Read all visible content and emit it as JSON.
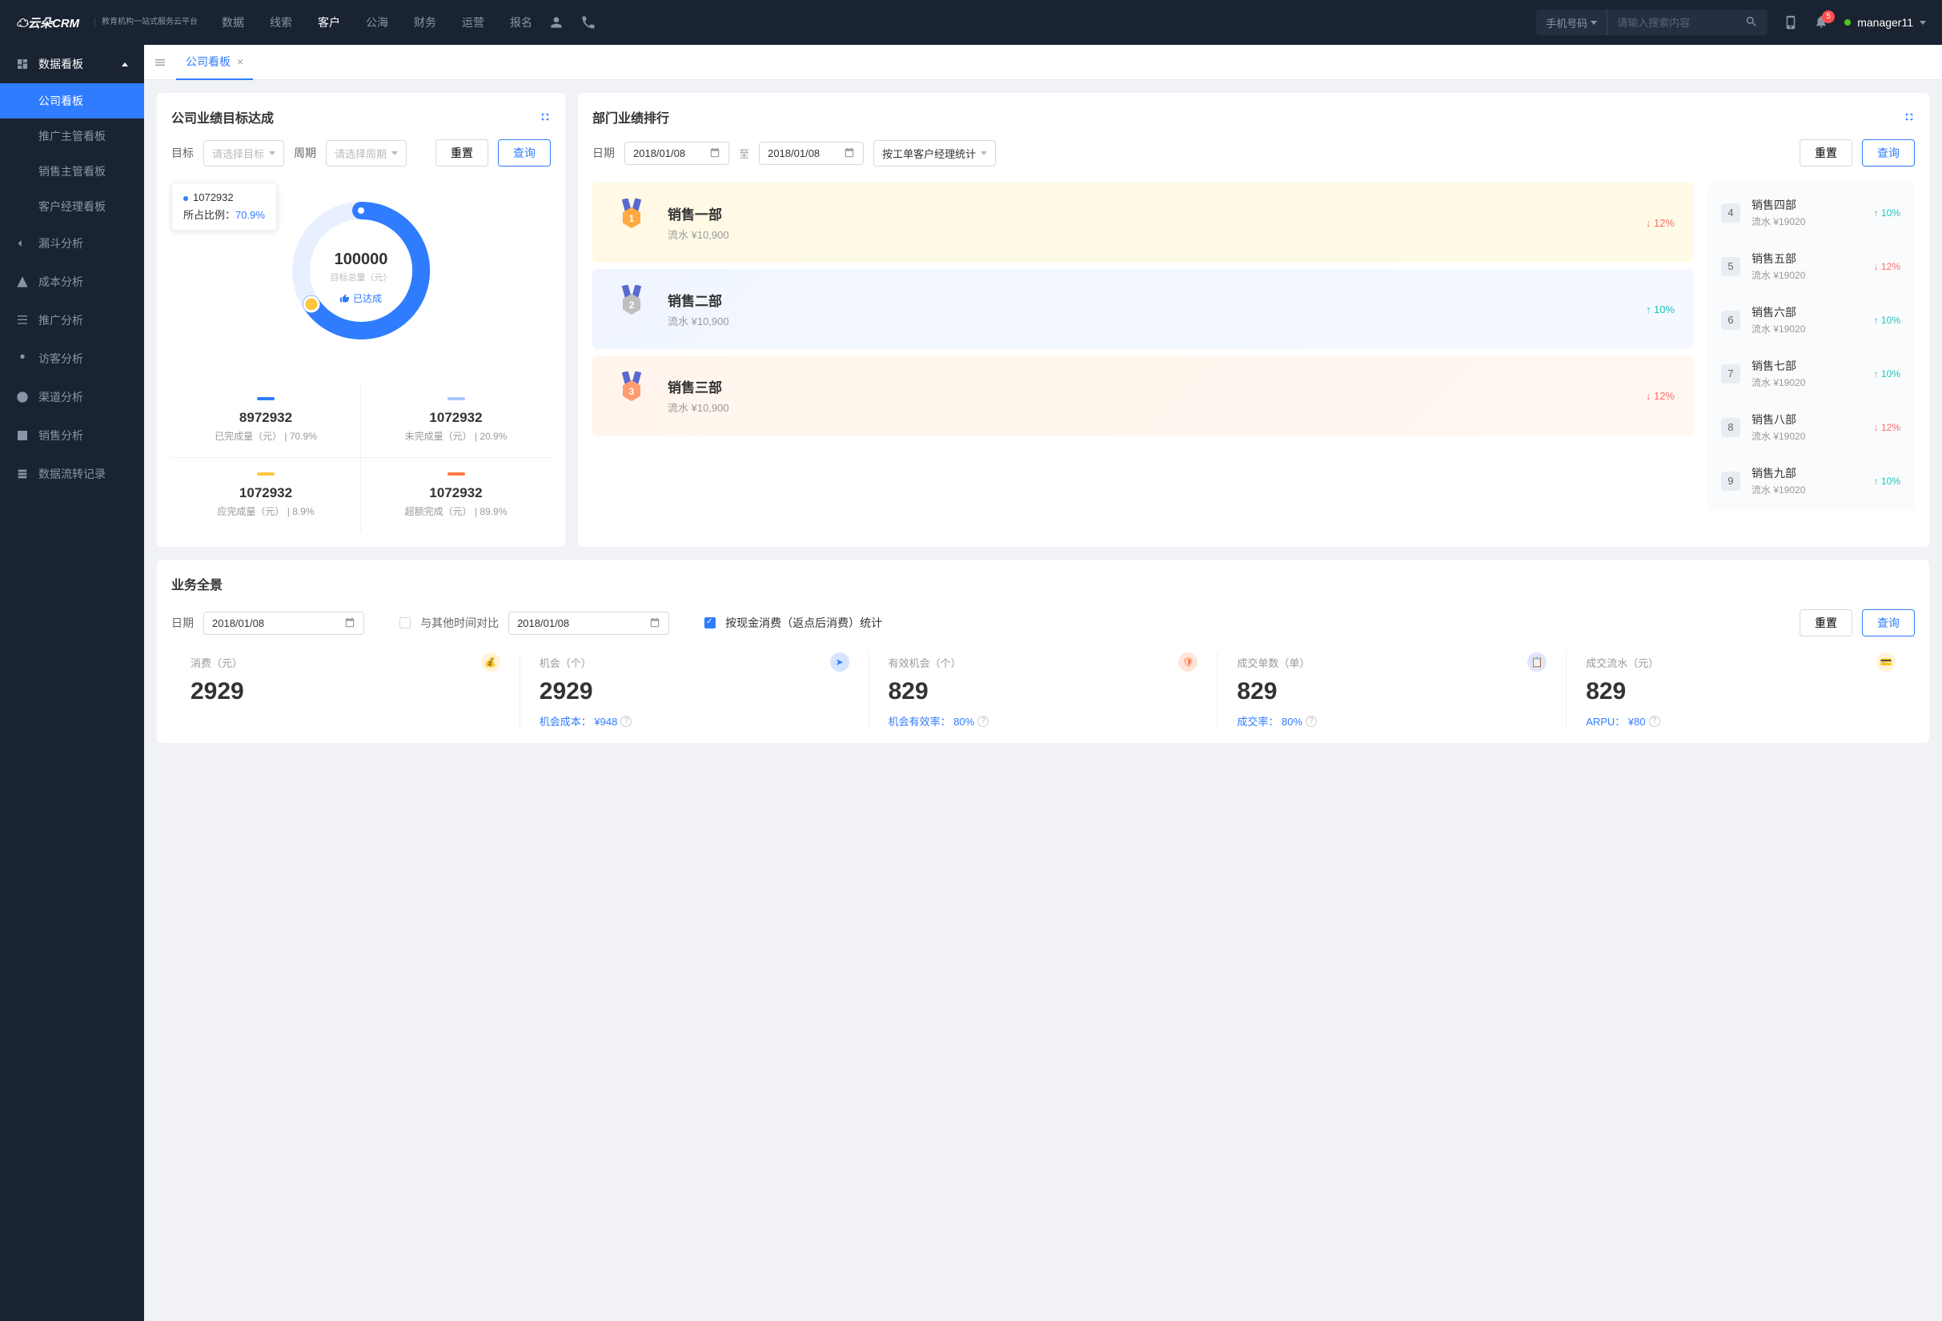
{
  "logo_suffix": "教育机构一站式服务云平台",
  "nav": [
    "数据",
    "线索",
    "客户",
    "公海",
    "财务",
    "运营",
    "报名"
  ],
  "nav_active": 2,
  "search_type": "手机号码",
  "search_placeholder": "请输入搜索内容",
  "notif_count": "5",
  "username": "manager11",
  "sidebar": {
    "group": "数据看板",
    "subs": [
      "公司看板",
      "推广主管看板",
      "销售主管看板",
      "客户经理看板"
    ],
    "sub_active": 0,
    "items": [
      "漏斗分析",
      "成本分析",
      "推广分析",
      "访客分析",
      "渠道分析",
      "销售分析",
      "数据流转记录"
    ]
  },
  "tab": "公司看板",
  "card1": {
    "title": "公司业绩目标达成",
    "target_lbl": "目标",
    "target_ph": "请选择目标",
    "period_lbl": "周期",
    "period_ph": "请选择周期",
    "reset": "重置",
    "query": "查询",
    "tooltip_val": "1072932",
    "tooltip_lbl": "所占比例：",
    "tooltip_pct": "70.9%",
    "center_num": "100000",
    "center_lbl": "目标总量（元）",
    "center_badge": "已达成",
    "stats": [
      {
        "bar": "#2f7cff",
        "val": "8972932",
        "sub": "已完成量（元） | 70.9%"
      },
      {
        "bar": "#a8c8ff",
        "val": "1072932",
        "sub": "未完成量（元） | 20.9%"
      },
      {
        "bar": "#ffc53d",
        "val": "1072932",
        "sub": "应完成量（元） | 8.9%"
      },
      {
        "bar": "#ff7a45",
        "val": "1072932",
        "sub": "超额完成（元） | 89.9%"
      }
    ]
  },
  "card2": {
    "title": "部门业绩排行",
    "date_lbl": "日期",
    "date1": "2018/01/08",
    "date_sep": "至",
    "date2": "2018/01/08",
    "stat_by": "按工单客户经理统计",
    "reset": "重置",
    "query": "查询",
    "top3": [
      {
        "cls": "gold",
        "name": "销售一部",
        "rev": "流水 ¥10,900",
        "chg": "12%",
        "dir": "down"
      },
      {
        "cls": "silver",
        "name": "销售二部",
        "rev": "流水 ¥10,900",
        "chg": "10%",
        "dir": "up"
      },
      {
        "cls": "bronze",
        "name": "销售三部",
        "rev": "流水 ¥10,900",
        "chg": "12%",
        "dir": "down"
      }
    ],
    "rest": [
      {
        "n": "4",
        "name": "销售四部",
        "rev": "流水 ¥19020",
        "chg": "10%",
        "dir": "up"
      },
      {
        "n": "5",
        "name": "销售五部",
        "rev": "流水 ¥19020",
        "chg": "12%",
        "dir": "down"
      },
      {
        "n": "6",
        "name": "销售六部",
        "rev": "流水 ¥19020",
        "chg": "10%",
        "dir": "up"
      },
      {
        "n": "7",
        "name": "销售七部",
        "rev": "流水 ¥19020",
        "chg": "10%",
        "dir": "up"
      },
      {
        "n": "8",
        "name": "销售八部",
        "rev": "流水 ¥19020",
        "chg": "12%",
        "dir": "down"
      },
      {
        "n": "9",
        "name": "销售九部",
        "rev": "流水 ¥19020",
        "chg": "10%",
        "dir": "up"
      }
    ]
  },
  "card3": {
    "title": "业务全景",
    "date_lbl": "日期",
    "date1": "2018/01/08",
    "compare_lbl": "与其他时间对比",
    "date2": "2018/01/08",
    "cash_lbl": "按现金消费（返点后消费）统计",
    "reset": "重置",
    "query": "查询",
    "kpis": [
      {
        "label": "消费（元）",
        "val": "2929",
        "sub": "",
        "color": "#ffc53d"
      },
      {
        "label": "机会（个）",
        "val": "2929",
        "sub": "机会成本： ¥948",
        "color": "#2f7cff"
      },
      {
        "label": "有效机会（个）",
        "val": "829",
        "sub": "机会有效率： 80%",
        "color": "#ff7a45"
      },
      {
        "label": "成交单数（单）",
        "val": "829",
        "sub": "成交率： 80%",
        "color": "#597ef7"
      },
      {
        "label": "成交流水（元）",
        "val": "829",
        "sub": "ARPU： ¥80",
        "color": "#ffc53d"
      }
    ]
  },
  "chart_data": {
    "type": "pie",
    "title": "目标总量（元）",
    "total": 100000,
    "series": [
      {
        "name": "已完成量",
        "value": 8972932,
        "pct": 70.9,
        "color": "#2f7cff"
      },
      {
        "name": "未完成量",
        "value": 1072932,
        "pct": 20.9,
        "color": "#a8c8ff"
      },
      {
        "name": "应完成量",
        "value": 1072932,
        "pct": 8.9,
        "color": "#ffc53d"
      },
      {
        "name": "超额完成",
        "value": 1072932,
        "pct": 89.9,
        "color": "#ff7a45"
      }
    ]
  }
}
